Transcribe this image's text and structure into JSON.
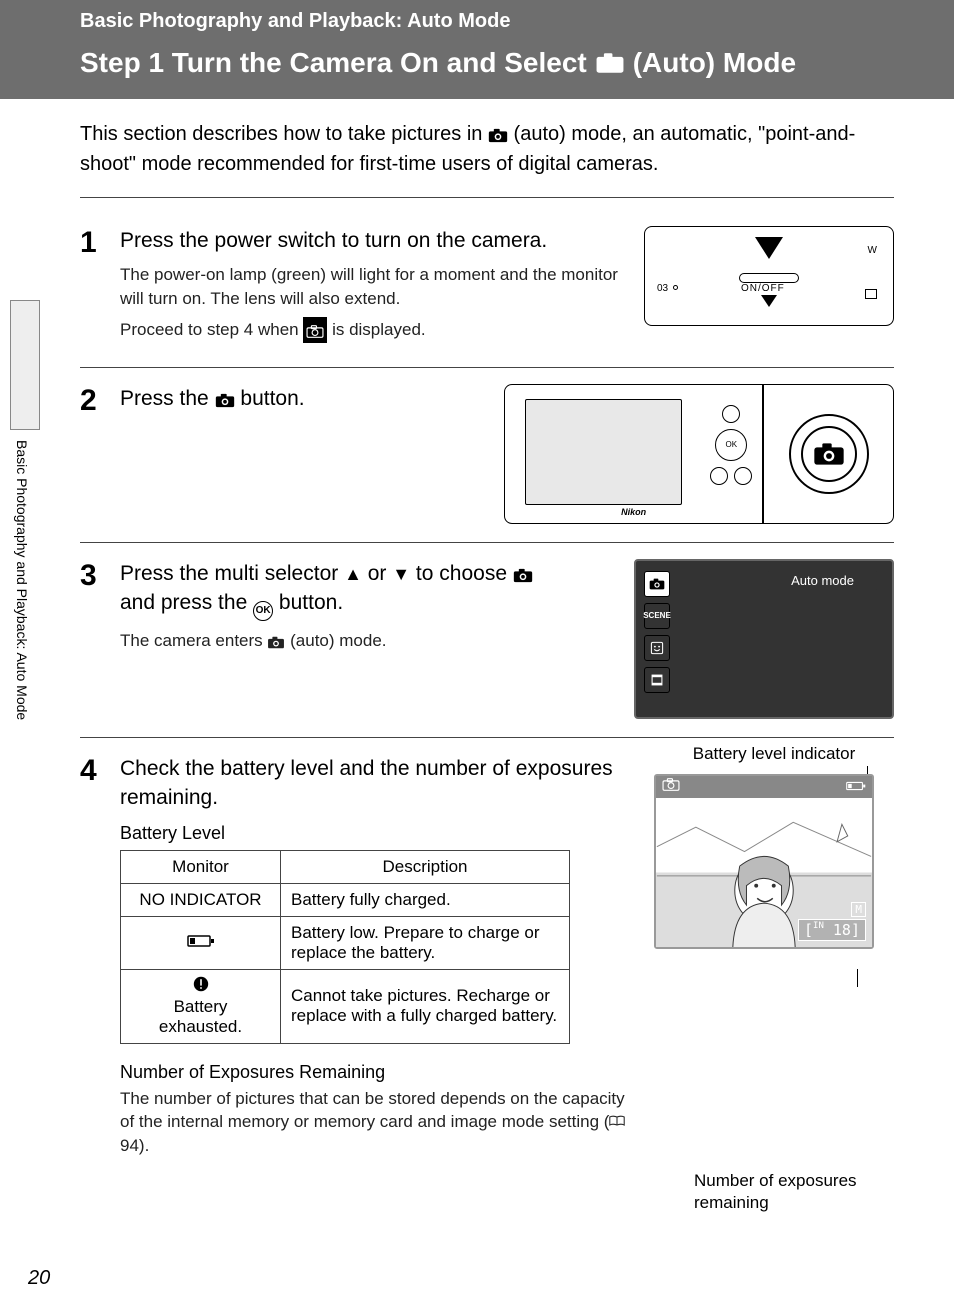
{
  "header": {
    "section": "Basic Photography and Playback: Auto Mode",
    "title_prefix": "Step 1 Turn the Camera On and Select ",
    "title_suffix": " (Auto) Mode"
  },
  "sidebar_text": "Basic Photography and Playback: Auto Mode",
  "intro": {
    "line1_pre": "This section describes how to take pictures in ",
    "line1_post": " (auto) mode, an automatic, \"point-and-shoot\" mode recommended for first-time users of digital cameras."
  },
  "steps": {
    "s1": {
      "num": "1",
      "heading": "Press the power switch to turn on the camera.",
      "desc1": "The power-on lamp (green) will light for a moment and the monitor will turn on. The lens will also extend.",
      "desc2_pre": "Proceed to step 4 when ",
      "desc2_post": " is displayed.",
      "illus_onoff": "ON/OFF",
      "illus_03": "03"
    },
    "s2": {
      "num": "2",
      "heading_pre": "Press the ",
      "heading_post": " button.",
      "nikon": "Nikon"
    },
    "s3": {
      "num": "3",
      "heading_pre": "Press the multi selector ",
      "heading_mid": " or ",
      "heading_mid2": " to choose ",
      "heading_line2_pre": "and press the ",
      "heading_line2_post": " button.",
      "ok_label": "OK",
      "desc_pre": "The camera enters ",
      "desc_post": " (auto) mode.",
      "menu_label": "Auto mode",
      "menu_scene": "SCENE"
    },
    "s4": {
      "num": "4",
      "heading": "Check the battery level and the number of exposures remaining.",
      "sub1": "Battery Level",
      "table": {
        "h1": "Monitor",
        "h2": "Description",
        "r1c1": "NO INDICATOR",
        "r1c2": "Battery fully charged.",
        "r2c2": "Battery low. Prepare to charge or replace the battery.",
        "r3c1_line1": "Battery",
        "r3c1_line2": "exhausted.",
        "r3c2": "Cannot take pictures. Recharge or replace with a fully charged battery."
      },
      "sub2": "Number of Exposures Remaining",
      "desc2_pre": "The number of pictures that can be stored depends on the capacity of the internal memory or memory card and image mode setting (",
      "desc2_ref": " 94).",
      "right": {
        "label_top": "Battery level indicator",
        "label_bottom_l1": "Number of exposures",
        "label_bottom_l2": "remaining",
        "count": "18",
        "count_prefix": "IN",
        "mode_icon": "M"
      }
    }
  },
  "page_number": "20"
}
